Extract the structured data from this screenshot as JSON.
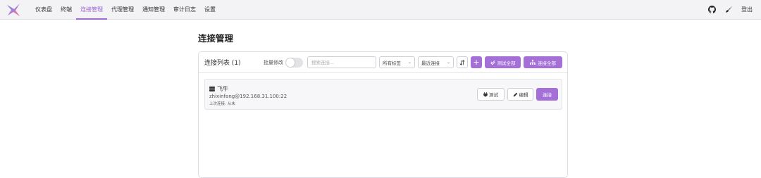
{
  "nav": {
    "items": [
      {
        "label": "仪表盘",
        "active": false
      },
      {
        "label": "终端",
        "active": false
      },
      {
        "label": "连接管理",
        "active": true
      },
      {
        "label": "代理管理",
        "active": false
      },
      {
        "label": "通知管理",
        "active": false
      },
      {
        "label": "审计日志",
        "active": false
      },
      {
        "label": "设置",
        "active": false
      }
    ],
    "logout_label": "登出"
  },
  "page": {
    "title": "连接管理"
  },
  "list": {
    "title": "连接列表 (1)",
    "batch_edit_label": "批量修改",
    "batch_edit_enabled": false,
    "search_placeholder": "搜索连接...",
    "tags_filter_value": "所有标签",
    "sort_value": "最近连接",
    "test_all_label": "测试全部",
    "connect_all_label": "连接全部"
  },
  "connections": [
    {
      "name": "飞牛",
      "address": "zhixinfang@192.168.31.100:22",
      "last_label": "上次连接:",
      "last_value": "从未",
      "test_label": "测试",
      "edit_label": "编辑",
      "connect_label": "连接"
    }
  ],
  "colors": {
    "accent": "#a470d8",
    "active_nav": "#9c63d9"
  },
  "icons": [
    "app-logo-icon",
    "github-icon",
    "brush-icon",
    "toggle",
    "chevron-down-icon",
    "sort-icon",
    "plus-icon",
    "check-double-icon",
    "sitemap-icon",
    "server-icon",
    "plug-icon",
    "pencil-icon"
  ]
}
